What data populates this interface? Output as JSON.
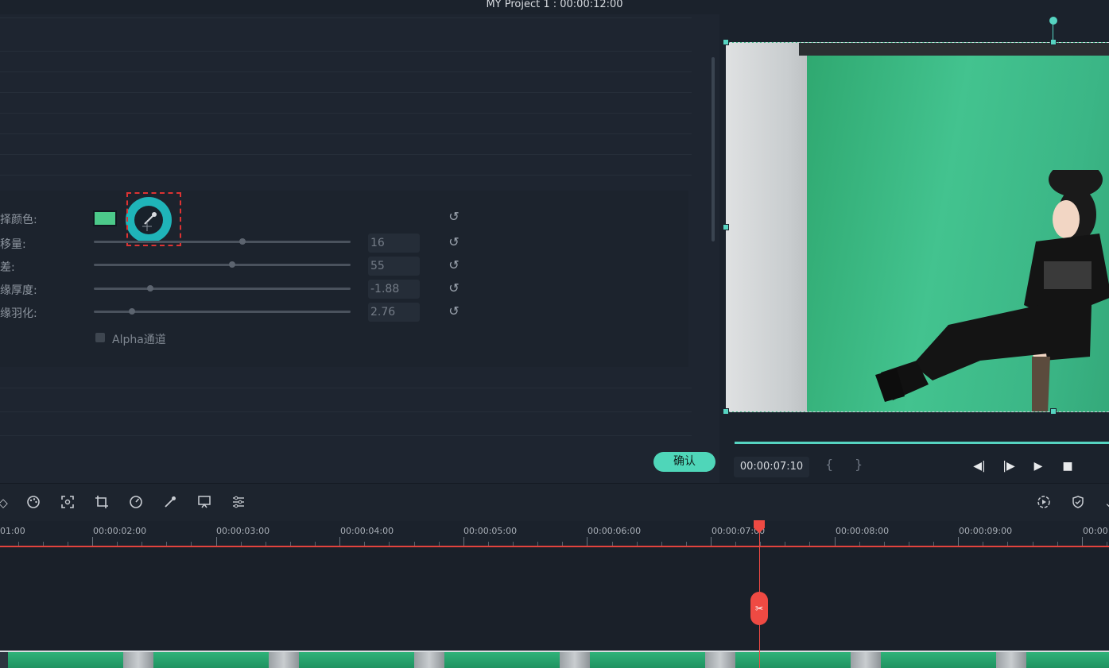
{
  "window": {
    "title": "MY Project 1 : 00:00:12:00"
  },
  "params": {
    "rows": [
      {
        "label": "择颜色:"
      },
      {
        "label": "移量:",
        "value": "16",
        "slider": 0.58
      },
      {
        "label": "差:",
        "value": "55",
        "slider": 0.54
      },
      {
        "label": "缘厚度:",
        "value": "-1.88",
        "slider": 0.22
      },
      {
        "label": "缘羽化:",
        "value": "2.76",
        "slider": 0.15
      }
    ],
    "alpha_label": "Alpha通道",
    "swatch_color": "#4cc98a"
  },
  "ok_button": "确认",
  "preview": {
    "timecode": "00:00:07:10",
    "brace_open": "{",
    "brace_close": "}"
  },
  "ruler": {
    "labels": [
      "01:00",
      "00:00:02:00",
      "00:00:03:00",
      "00:00:04:00",
      "00:00:05:00",
      "00:00:06:00",
      "00:00:07:00",
      "00:00:08:00",
      "00:00:09:00",
      "00:00:"
    ]
  },
  "icons": {
    "toolbar": [
      "diamond-icon",
      "palette-icon",
      "focus-icon",
      "crop-icon",
      "speed-icon",
      "eyedropper-icon",
      "screen-icon",
      "adjust-icon"
    ],
    "toolbar_right": [
      "render-icon",
      "shield-icon"
    ]
  },
  "accent": "#56d4c1",
  "playhead_color": "#ef4a43"
}
